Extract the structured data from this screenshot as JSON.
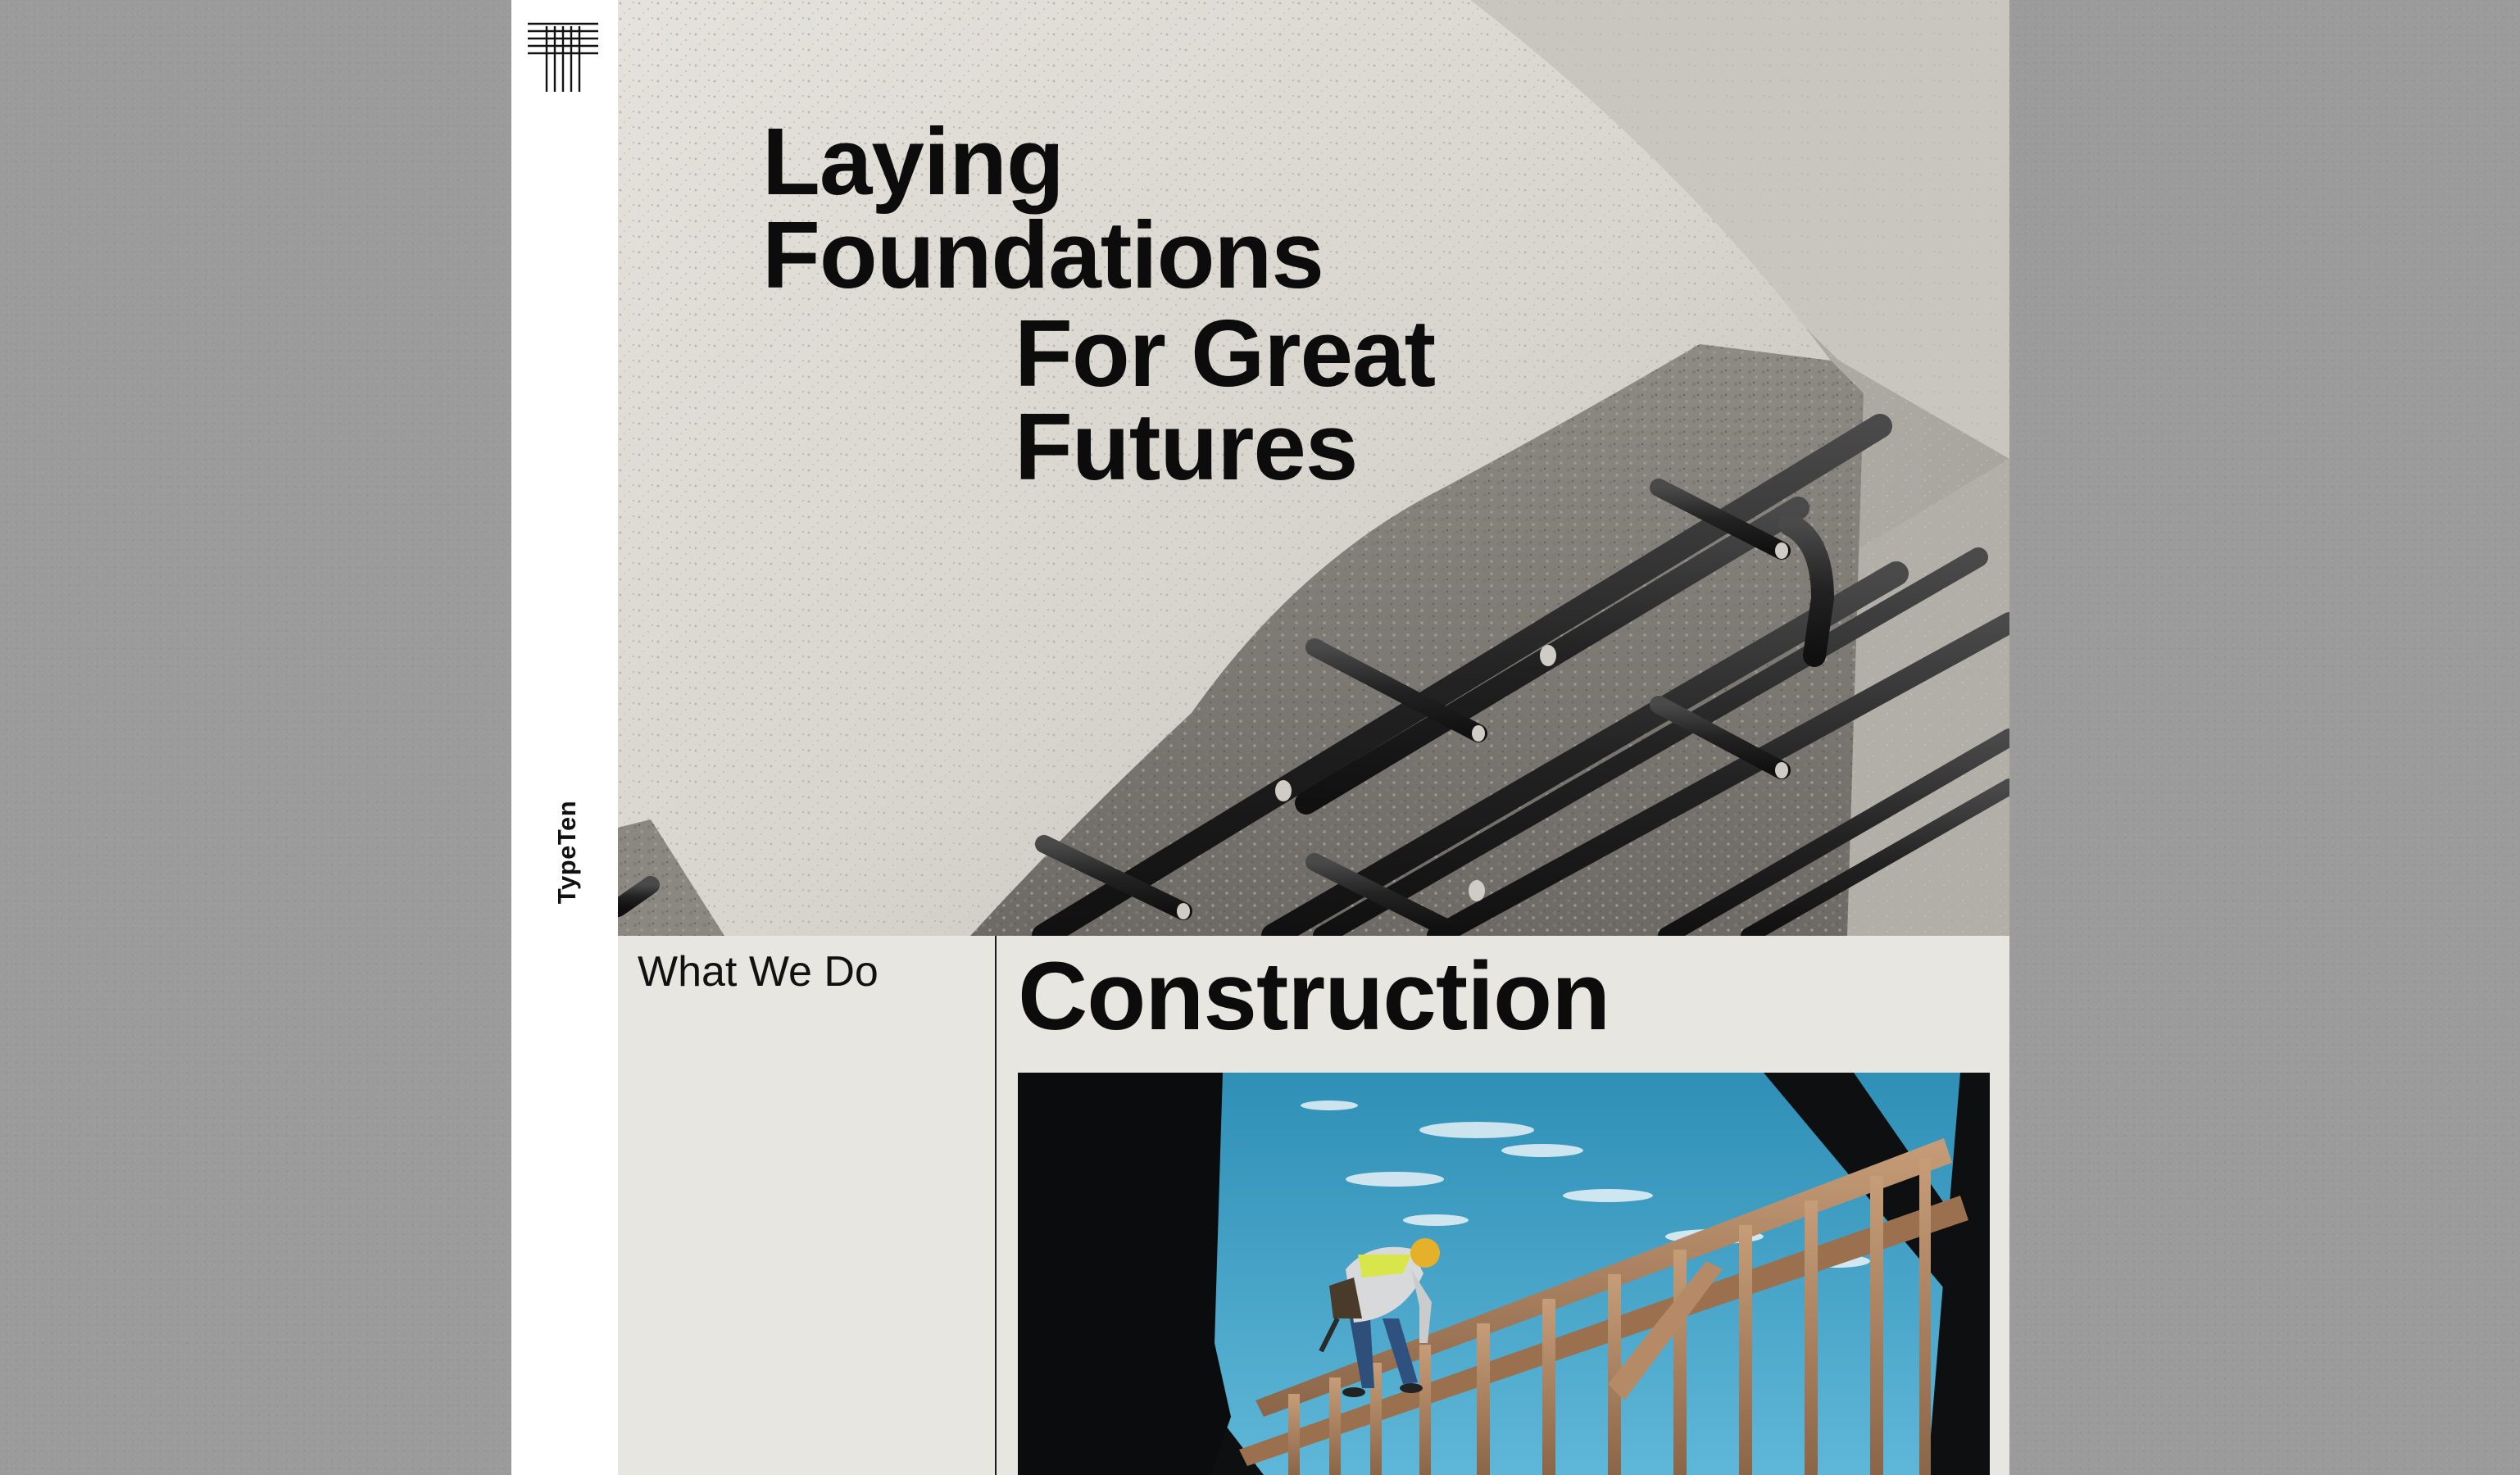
{
  "brand": {
    "name": "TypeTen",
    "logo_icon": "typeten-grid-logo-icon"
  },
  "hero": {
    "headline_lines": [
      "Laying",
      "Foundations",
      "For Great",
      "Futures"
    ],
    "image": "concrete-slab-rebar-image"
  },
  "section": {
    "label": "What We Do",
    "title": "Construction",
    "image": "worker-on-timber-frame-image"
  },
  "colors": {
    "backdrop": "#9b9b9b",
    "page": "#ffffff",
    "lower_panel": "#e8e6e1",
    "text": "#0c0c0c",
    "sky": "#3f9fc4"
  }
}
